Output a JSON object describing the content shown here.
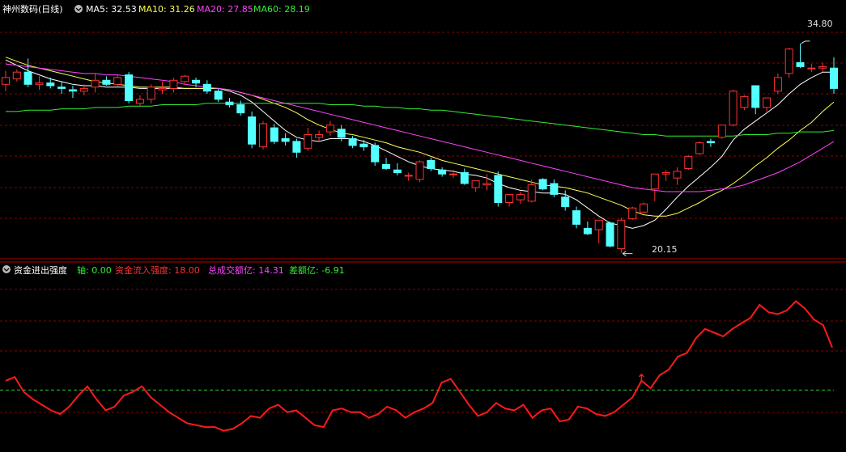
{
  "top_legend": {
    "stock": "神州数码(日线)",
    "items": [
      {
        "label": "MA5: 32.53",
        "color": "#ffffff"
      },
      {
        "label": "MA10: 31.26",
        "color": "#ffff55"
      },
      {
        "label": "MA20: 27.85",
        "color": "#ff44ff"
      },
      {
        "label": "MA60: 28.19",
        "color": "#33ee33"
      }
    ]
  },
  "bottom_legend": {
    "indicator": "资金进出强度",
    "items": [
      {
        "label": "轴: 0.00",
        "color": "#33ee33"
      },
      {
        "label": "资金流入强度: 18.00",
        "color": "#ff3333"
      },
      {
        "label": "总成交额亿: 14.31",
        "color": "#ff44ff"
      },
      {
        "label": "差额亿: -6.91",
        "color": "#33ee33"
      }
    ]
  },
  "annotations": {
    "high": "34.80",
    "low": "20.15"
  },
  "colors": {
    "up": "#ff3232",
    "down": "#54ffff",
    "grid": "#8b0000"
  },
  "chart_data": [
    {
      "type": "candlestick",
      "price_range": [
        19.0,
        36.5
      ],
      "ohlc": [
        [
          31.6,
          32.6,
          31.1,
          32.1
        ],
        [
          32.0,
          32.7,
          31.8,
          32.5
        ],
        [
          32.5,
          33.5,
          31.4,
          31.6
        ],
        [
          31.6,
          32.2,
          31.2,
          31.7
        ],
        [
          31.7,
          32.1,
          31.3,
          31.5
        ],
        [
          31.4,
          31.8,
          30.9,
          31.3
        ],
        [
          31.2,
          31.5,
          30.6,
          31.1
        ],
        [
          31.1,
          31.6,
          30.8,
          31.3
        ],
        [
          31.4,
          32.4,
          31.0,
          31.9
        ],
        [
          31.9,
          32.2,
          31.5,
          31.6
        ],
        [
          31.6,
          32.3,
          31.4,
          32.1
        ],
        [
          32.3,
          32.5,
          30.2,
          30.4
        ],
        [
          30.2,
          30.8,
          30.0,
          30.5
        ],
        [
          30.5,
          31.6,
          30.2,
          31.4
        ],
        [
          31.2,
          31.8,
          30.9,
          31.3
        ],
        [
          31.3,
          32.1,
          31.0,
          31.9
        ],
        [
          31.8,
          32.3,
          31.6,
          32.2
        ],
        [
          31.9,
          32.1,
          31.4,
          31.7
        ],
        [
          31.6,
          31.9,
          30.9,
          31.1
        ],
        [
          31.1,
          31.3,
          30.3,
          30.5
        ],
        [
          30.3,
          30.6,
          29.9,
          30.1
        ],
        [
          30.1,
          30.4,
          29.3,
          29.5
        ],
        [
          29.2,
          29.6,
          26.9,
          27.2
        ],
        [
          27.0,
          28.9,
          26.8,
          28.7
        ],
        [
          28.4,
          28.7,
          27.2,
          27.4
        ],
        [
          27.6,
          28.0,
          27.1,
          27.4
        ],
        [
          27.4,
          27.6,
          26.2,
          26.6
        ],
        [
          26.9,
          28.4,
          26.7,
          27.9
        ],
        [
          27.7,
          28.2,
          27.4,
          27.9
        ],
        [
          28.1,
          28.9,
          27.8,
          28.6
        ],
        [
          28.3,
          28.6,
          27.4,
          27.7
        ],
        [
          27.6,
          27.8,
          26.9,
          27.1
        ],
        [
          27.2,
          27.5,
          26.7,
          27.0
        ],
        [
          27.1,
          27.3,
          25.6,
          25.9
        ],
        [
          25.7,
          26.2,
          25.3,
          25.4
        ],
        [
          25.3,
          25.8,
          24.9,
          25.1
        ],
        [
          24.9,
          25.1,
          24.5,
          24.9
        ],
        [
          24.6,
          26.0,
          24.4,
          25.9
        ],
        [
          26.0,
          26.2,
          25.2,
          25.4
        ],
        [
          25.3,
          25.5,
          24.8,
          25.0
        ],
        [
          25.0,
          25.3,
          24.7,
          25.0
        ],
        [
          25.1,
          25.4,
          24.2,
          24.3
        ],
        [
          24.0,
          24.5,
          23.7,
          24.5
        ],
        [
          24.2,
          25.0,
          23.8,
          24.3
        ],
        [
          24.9,
          25.2,
          22.6,
          22.9
        ],
        [
          22.9,
          23.5,
          22.6,
          23.5
        ],
        [
          23.1,
          23.7,
          22.8,
          23.5
        ],
        [
          23.0,
          24.6,
          22.9,
          24.2
        ],
        [
          24.6,
          24.7,
          23.8,
          23.9
        ],
        [
          24.3,
          24.6,
          23.3,
          23.5
        ],
        [
          23.3,
          23.8,
          22.3,
          22.6
        ],
        [
          22.3,
          22.6,
          21.0,
          21.3
        ],
        [
          21.0,
          21.5,
          20.5,
          20.6
        ],
        [
          20.9,
          21.4,
          19.9,
          21.6
        ],
        [
          21.4,
          21.5,
          19.6,
          19.7
        ],
        [
          19.5,
          21.8,
          19.2,
          21.6
        ],
        [
          21.7,
          22.6,
          21.6,
          22.5
        ],
        [
          22.2,
          22.9,
          22.1,
          22.8
        ],
        [
          23.9,
          25.0,
          23.0,
          25.0
        ],
        [
          25.0,
          25.3,
          24.5,
          25.1
        ],
        [
          24.7,
          25.5,
          24.2,
          25.2
        ],
        [
          25.4,
          26.4,
          25.3,
          26.3
        ],
        [
          26.5,
          27.4,
          26.4,
          27.3
        ],
        [
          27.4,
          27.6,
          27.0,
          27.3
        ],
        [
          27.7,
          28.6,
          27.6,
          28.6
        ],
        [
          28.6,
          31.2,
          28.5,
          31.1
        ],
        [
          29.9,
          30.8,
          29.7,
          30.7
        ],
        [
          31.5,
          31.5,
          29.4,
          29.9
        ],
        [
          29.9,
          30.6,
          29.6,
          30.6
        ],
        [
          31.1,
          32.4,
          30.9,
          32.1
        ],
        [
          32.4,
          34.3,
          32.1,
          34.2
        ],
        [
          33.2,
          34.6,
          32.8,
          32.9
        ],
        [
          32.8,
          33.1,
          32.5,
          32.8
        ],
        [
          32.8,
          33.2,
          32.5,
          32.9
        ],
        [
          32.8,
          33.6,
          30.9,
          31.3
        ]
      ],
      "ma": [
        {
          "name": "MA5",
          "color": "#ffffff",
          "values": [
            33.4,
            33.0,
            32.6,
            32.3,
            32.0,
            31.8,
            31.6,
            31.5,
            31.5,
            31.4,
            31.4,
            31.4,
            31.3,
            31.3,
            31.3,
            31.3,
            31.3,
            31.3,
            31.3,
            31.3,
            31.1,
            30.8,
            30.3,
            29.6,
            28.9,
            28.2,
            27.7,
            27.5,
            27.4,
            27.6,
            27.6,
            27.6,
            27.4,
            27.1,
            26.7,
            26.3,
            25.9,
            25.6,
            25.4,
            25.3,
            25.2,
            25.0,
            24.9,
            24.7,
            24.3,
            24.0,
            23.8,
            23.7,
            23.6,
            23.6,
            23.5,
            23.1,
            22.5,
            21.9,
            21.4,
            21.2,
            21.0,
            21.2,
            21.6,
            22.4,
            23.3,
            24.1,
            24.8,
            25.5,
            26.3,
            27.5,
            28.3,
            28.9,
            29.5,
            30.1,
            30.9,
            31.6,
            32.1,
            32.5,
            32.5
          ]
        },
        {
          "name": "MA10",
          "color": "#ffff55",
          "values": [
            33.6,
            33.3,
            33.0,
            32.8,
            32.6,
            32.4,
            32.2,
            32.0,
            31.8,
            31.7,
            31.6,
            31.5,
            31.4,
            31.4,
            31.4,
            31.4,
            31.3,
            31.3,
            31.3,
            31.3,
            31.2,
            31.0,
            30.8,
            30.5,
            30.2,
            29.9,
            29.5,
            29.0,
            28.6,
            28.3,
            28.0,
            27.9,
            27.7,
            27.5,
            27.3,
            27.0,
            26.8,
            26.6,
            26.3,
            26.0,
            25.8,
            25.6,
            25.4,
            25.2,
            25.0,
            24.8,
            24.6,
            24.4,
            24.2,
            24.1,
            24.0,
            23.8,
            23.6,
            23.3,
            23.0,
            22.7,
            22.3,
            22.0,
            21.9,
            21.9,
            22.1,
            22.5,
            22.9,
            23.4,
            23.8,
            24.3,
            24.9,
            25.6,
            26.2,
            26.9,
            27.5,
            28.2,
            28.8,
            29.6,
            30.3
          ]
        },
        {
          "name": "MA20",
          "color": "#ff44ff",
          "values": [
            33.1,
            33.0,
            32.9,
            32.8,
            32.7,
            32.6,
            32.5,
            32.4,
            32.4,
            32.3,
            32.3,
            32.2,
            32.1,
            32.0,
            31.9,
            31.8,
            31.6,
            31.5,
            31.4,
            31.3,
            31.2,
            31.0,
            30.8,
            30.6,
            30.4,
            30.2,
            30.0,
            29.8,
            29.6,
            29.4,
            29.2,
            29.0,
            28.8,
            28.6,
            28.4,
            28.2,
            28.0,
            27.8,
            27.6,
            27.4,
            27.2,
            27.0,
            26.8,
            26.6,
            26.4,
            26.2,
            26.0,
            25.8,
            25.6,
            25.4,
            25.2,
            25.0,
            24.8,
            24.6,
            24.4,
            24.2,
            24.0,
            23.9,
            23.8,
            23.7,
            23.7,
            23.7,
            23.7,
            23.8,
            23.9,
            24.0,
            24.2,
            24.5,
            24.8,
            25.1,
            25.5,
            25.9,
            26.4,
            26.9,
            27.4
          ]
        },
        {
          "name": "MA60",
          "color": "#33ee33",
          "values": [
            29.6,
            29.6,
            29.7,
            29.7,
            29.7,
            29.8,
            29.8,
            29.8,
            29.9,
            29.9,
            29.9,
            30.0,
            30.0,
            30.0,
            30.1,
            30.1,
            30.1,
            30.1,
            30.2,
            30.2,
            30.2,
            30.2,
            30.2,
            30.2,
            30.2,
            30.2,
            30.2,
            30.2,
            30.2,
            30.1,
            30.1,
            30.1,
            30.0,
            30.0,
            29.9,
            29.9,
            29.8,
            29.8,
            29.7,
            29.7,
            29.6,
            29.5,
            29.4,
            29.3,
            29.2,
            29.1,
            29.0,
            28.9,
            28.8,
            28.7,
            28.6,
            28.5,
            28.4,
            28.3,
            28.2,
            28.1,
            28.0,
            27.9,
            27.9,
            27.8,
            27.8,
            27.8,
            27.8,
            27.8,
            27.8,
            27.8,
            27.9,
            27.9,
            27.9,
            28.0,
            28.0,
            28.1,
            28.1,
            28.1,
            28.2
          ]
        }
      ]
    },
    {
      "type": "line",
      "value_range": [
        -30,
        60
      ],
      "axis_value": 0,
      "name": "资金流入强度",
      "values": [
        5,
        7,
        -1,
        -5,
        -8,
        -11,
        -13,
        -9,
        -3,
        2,
        -5,
        -11,
        -9,
        -3,
        -1,
        2,
        -4,
        -8,
        -12,
        -15,
        -18,
        -19,
        -20,
        -20,
        -22,
        -21,
        -18,
        -14,
        -15,
        -10,
        -8,
        -12,
        -11,
        -15,
        -19,
        -20,
        -11,
        -10,
        -12,
        -12,
        -15,
        -13,
        -9,
        -11,
        -15,
        -12,
        -10,
        -7,
        4,
        6,
        -1,
        -8,
        -14,
        -12,
        -7,
        -10,
        -11,
        -8,
        -15,
        -11,
        -10,
        -17,
        -16,
        -9,
        -10,
        -13,
        -14,
        -12,
        -8,
        -4,
        5,
        1,
        8,
        11,
        18,
        20,
        28,
        33,
        31,
        29,
        33,
        36,
        39,
        46,
        42,
        41,
        43,
        48,
        44,
        38,
        35,
        23
      ]
    }
  ]
}
